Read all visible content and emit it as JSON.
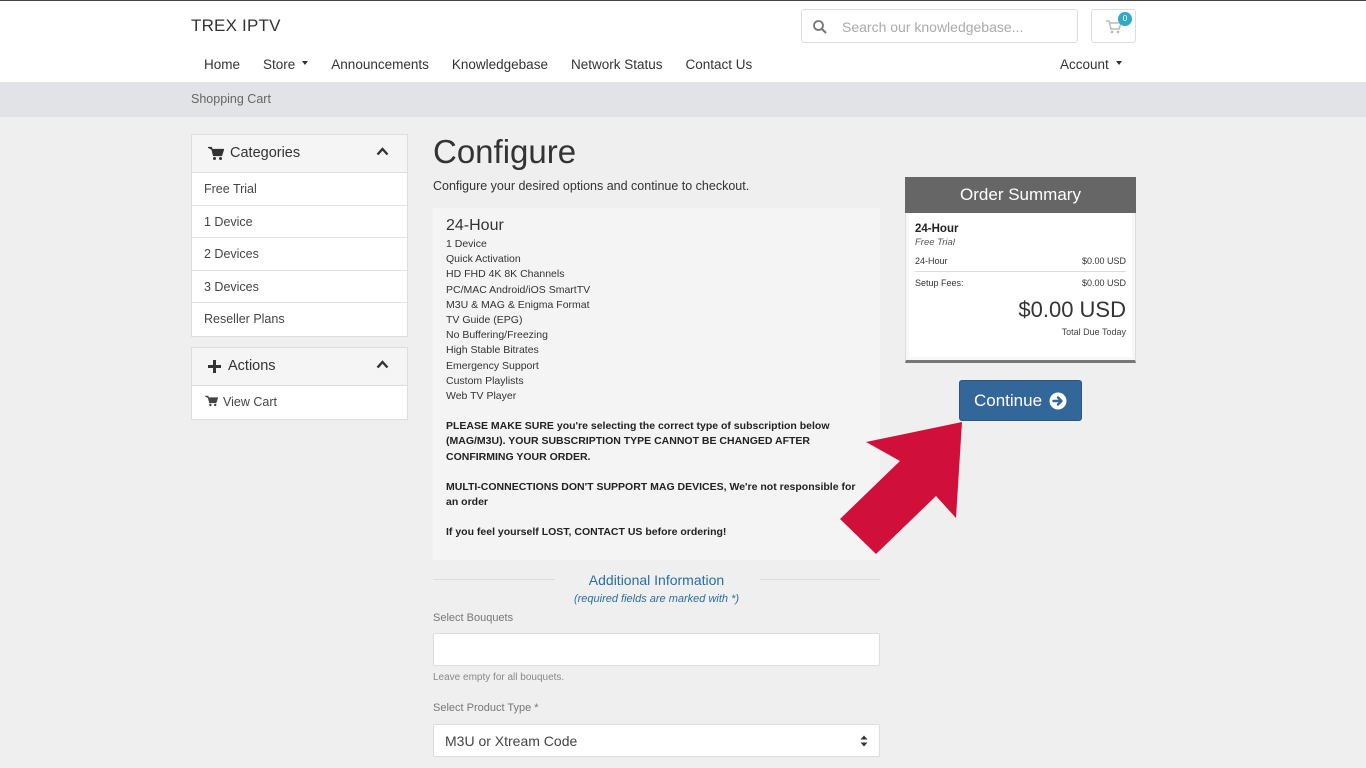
{
  "header": {
    "brand": "TREX IPTV",
    "search_placeholder": "Search our knowledgebase...",
    "cart_count": "0",
    "nav": [
      "Home",
      "Store",
      "Announcements",
      "Knowledgebase",
      "Network Status",
      "Contact Us"
    ],
    "account": "Account"
  },
  "breadcrumb": "Shopping Cart",
  "sidebar": {
    "categories": {
      "title": "Categories",
      "items": [
        "Free Trial",
        "1 Device",
        "2 Devices",
        "3 Devices",
        "Reseller Plans"
      ]
    },
    "actions": {
      "title": "Actions",
      "items": [
        "View Cart"
      ]
    }
  },
  "main": {
    "title": "Configure",
    "subtitle": "Configure your desired options and continue to checkout.",
    "product": {
      "name": "24-Hour",
      "features": [
        "1 Device",
        "Quick Activation",
        "HD FHD 4K 8K Channels",
        "PC/MAC Android/iOS SmartTV",
        "M3U & MAG & Enigma Format",
        "TV Guide (EPG)",
        "No Buffering/Freezing",
        "High Stable Bitrates",
        "Emergency Support",
        "Custom Playlists",
        "Web TV Player"
      ],
      "warning1": "PLEASE MAKE SURE you're selecting the correct type of subscription below (MAG/M3U). YOUR SUBSCRIPTION TYPE CANNOT BE CHANGED AFTER CONFIRMING YOUR ORDER.",
      "warning2": "MULTI-CONNECTIONS DON'T SUPPORT MAG DEVICES, We're not responsible for an order",
      "warning3": "If you feel yourself LOST, CONTACT US before ordering!"
    },
    "additional": {
      "title": "Additional Information",
      "required_note": "(required fields are marked with *)",
      "bouquets_label": "Select Bouquets",
      "bouquets_value": "",
      "bouquets_hint": "Leave empty for all bouquets.",
      "product_type_label": "Select Product Type *",
      "product_type_value": "M3U or Xtream Code"
    }
  },
  "summary": {
    "title": "Order Summary",
    "product_name": "24-Hour",
    "product_group": "Free Trial",
    "line_label": "24-Hour",
    "line_value": "$0.00 USD",
    "setup_label": "Setup Fees:",
    "setup_value": "$0.00 USD",
    "total": "$0.00 USD",
    "total_label": "Total Due Today",
    "continue_label": "Continue"
  },
  "colors": {
    "primary_button": "#336799",
    "link_blue": "#2b6ea0",
    "annotation_arrow": "#d0103a",
    "badge": "#31a9c6"
  }
}
